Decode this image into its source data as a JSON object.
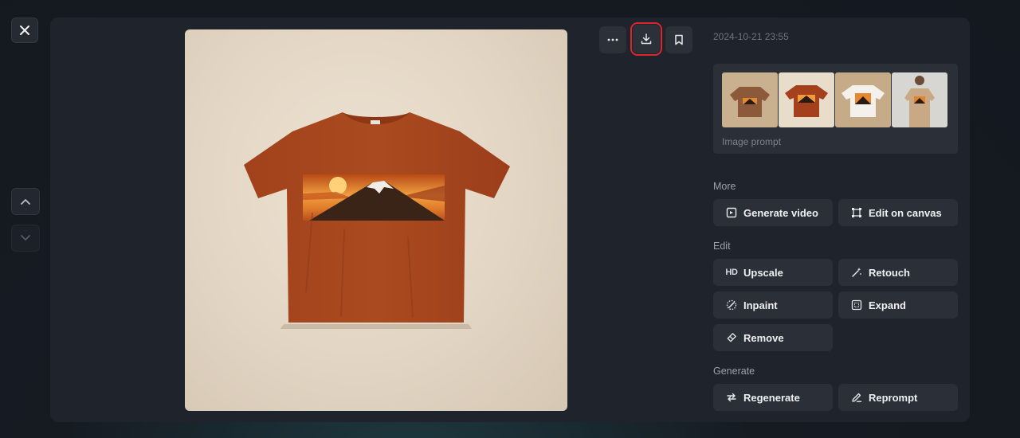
{
  "viewer": {
    "timestamp": "2024-10-21 23:55",
    "image_prompt_label": "Image prompt"
  },
  "sections": {
    "more": "More",
    "edit": "Edit",
    "generate": "Generate"
  },
  "actions": {
    "generate_video": "Generate video",
    "edit_on_canvas": "Edit on canvas",
    "upscale_badge": "HD",
    "upscale": "Upscale",
    "retouch": "Retouch",
    "inpaint": "Inpaint",
    "expand": "Expand",
    "remove": "Remove",
    "regenerate": "Regenerate",
    "reprompt": "Reprompt"
  },
  "icons": {
    "close": "close-icon",
    "up": "chevron-up-icon",
    "down": "chevron-down-icon",
    "more": "ellipsis-icon",
    "download": "download-icon",
    "bookmark": "bookmark-icon"
  },
  "colors": {
    "highlight": "#e0242b",
    "shirt": "#a8461f",
    "panel": "#1f232b",
    "button": "#2a2f38"
  }
}
